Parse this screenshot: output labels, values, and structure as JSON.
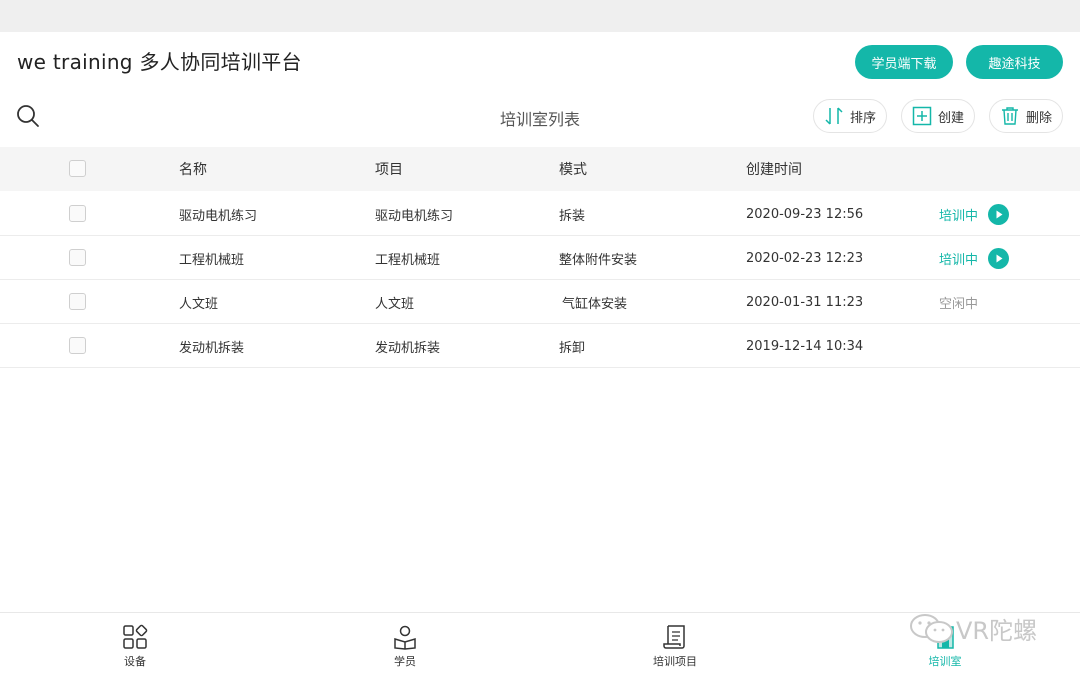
{
  "app": {
    "title": "we training 多人协同培训平台"
  },
  "header": {
    "download_label": "学员端下载",
    "company_label": "趣途科技"
  },
  "toolbar": {
    "title": "培训室列表",
    "sort_label": "排序",
    "create_label": "创建",
    "delete_label": "删除"
  },
  "table": {
    "columns": {
      "name": "名称",
      "project": "项目",
      "mode": "模式",
      "time": "创建时间"
    },
    "rows": [
      {
        "name": "驱动电机练习",
        "project": "驱动电机练习",
        "mode": "拆装",
        "time": "2020-09-23 12:56",
        "status": "培训中",
        "state": "active"
      },
      {
        "name": "工程机械班",
        "project": "工程机械班",
        "mode": "整体附件安装",
        "time": "2020-02-23 12:23",
        "status": "培训中",
        "state": "active"
      },
      {
        "name": "人文班",
        "project": "人文班",
        "mode": "气缸体安装",
        "time": "2020-01-31 11:23",
        "status": "空闲中",
        "state": "idle"
      },
      {
        "name": "发动机拆装",
        "project": "发动机拆装",
        "mode": "拆卸",
        "time": "2019-12-14 10:34",
        "status": "",
        "state": "none"
      }
    ]
  },
  "nav": {
    "items": [
      {
        "label": "设备",
        "icon": "grid-icon"
      },
      {
        "label": "学员",
        "icon": "person-book-icon"
      },
      {
        "label": "培训项目",
        "icon": "scroll-icon"
      },
      {
        "label": "培训室",
        "icon": "room-icon",
        "active": true
      }
    ]
  },
  "watermark": {
    "text": "VR陀螺"
  },
  "colors": {
    "accent": "#14b7a9",
    "header_bg": "#f5f5f5",
    "idle": "#999999"
  }
}
